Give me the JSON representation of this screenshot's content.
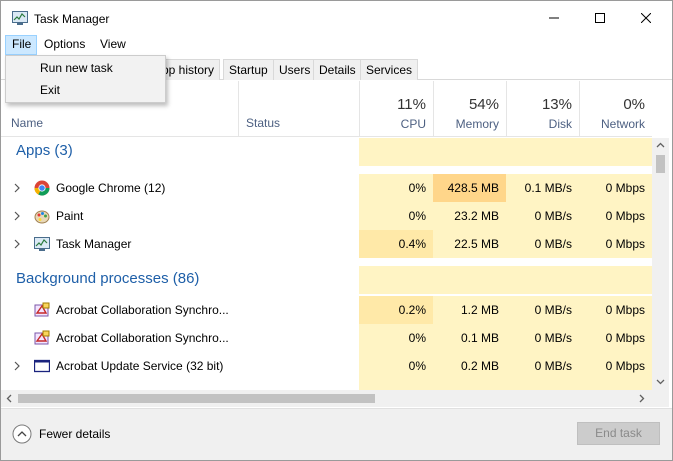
{
  "window": {
    "title": "Task Manager"
  },
  "menubar": {
    "file": "File",
    "options": "Options",
    "view": "View"
  },
  "file_menu": {
    "items": [
      "Run new task",
      "Exit"
    ]
  },
  "tabs": [
    "pp history",
    "Startup",
    "Users",
    "Details",
    "Services"
  ],
  "header": {
    "name": "Name",
    "status": "Status",
    "cpu": {
      "pct": "11%",
      "label": "CPU"
    },
    "memory": {
      "pct": "54%",
      "label": "Memory"
    },
    "disk": {
      "pct": "13%",
      "label": "Disk"
    },
    "network": {
      "pct": "0%",
      "label": "Network"
    }
  },
  "groups": {
    "apps": "Apps (3)",
    "background": "Background processes (86)"
  },
  "rows": [
    {
      "name": "Google Chrome (12)",
      "cpu": "0%",
      "memory": "428.5 MB",
      "disk": "0.1 MB/s",
      "network": "0 Mbps",
      "icon": "chrome-icon"
    },
    {
      "name": "Paint",
      "cpu": "0%",
      "memory": "23.2 MB",
      "disk": "0 MB/s",
      "network": "0 Mbps",
      "icon": "paint-icon"
    },
    {
      "name": "Task Manager",
      "cpu": "0.4%",
      "memory": "22.5 MB",
      "disk": "0 MB/s",
      "network": "0 Mbps",
      "icon": "task-manager-icon"
    },
    {
      "name": "Acrobat Collaboration Synchro...",
      "cpu": "0.2%",
      "memory": "1.2 MB",
      "disk": "0 MB/s",
      "network": "0 Mbps",
      "icon": "acrobat-icon"
    },
    {
      "name": "Acrobat Collaboration Synchro...",
      "cpu": "0%",
      "memory": "0.1 MB",
      "disk": "0 MB/s",
      "network": "0 Mbps",
      "icon": "acrobat-icon"
    },
    {
      "name": "Acrobat Update Service (32 bit)",
      "cpu": "0%",
      "memory": "0.2 MB",
      "disk": "0 MB/s",
      "network": "0 Mbps",
      "icon": "service-window-icon"
    }
  ],
  "footer": {
    "fewer_details": "Fewer details",
    "end_task": "End task"
  },
  "colors": {
    "heat_light": "#fff4c4",
    "heat_mid": "#ffe9a8",
    "heat_strong": "#ffd68a",
    "group_blue": "#1e5fa8",
    "menu_highlight": "#cce8ff"
  }
}
